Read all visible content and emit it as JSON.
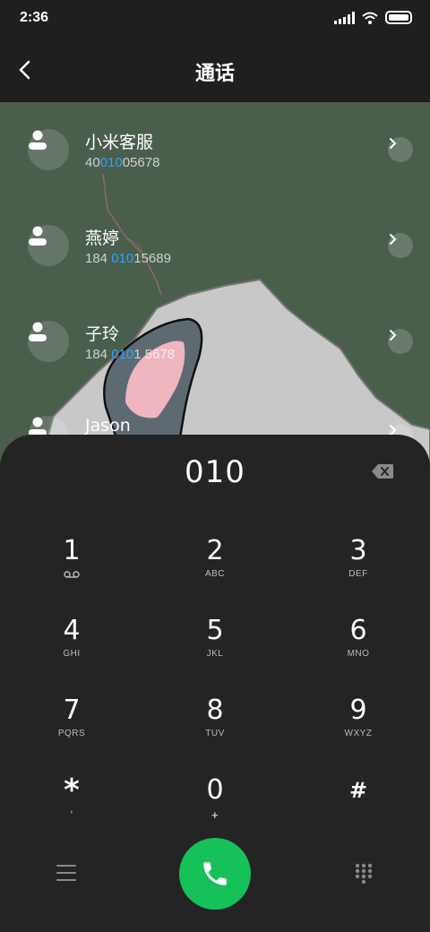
{
  "status_bar": {
    "time": "2:36"
  },
  "header": {
    "title": "通话"
  },
  "contacts": [
    {
      "name": "小米客服",
      "number_pre": "40",
      "number_match": "010",
      "number_post": "05678"
    },
    {
      "name": "燕婷",
      "number_pre": "184 ",
      "number_match": "010",
      "number_post": "15689"
    },
    {
      "name": "子玲",
      "number_pre": "184 ",
      "number_match": "010",
      "number_post": "1 5678"
    },
    {
      "name": "Jason",
      "number_pre": "",
      "number_match": "",
      "number_post": ""
    }
  ],
  "dialer": {
    "dialed_number": "010",
    "keys": [
      {
        "digit": "1",
        "letters": ""
      },
      {
        "digit": "2",
        "letters": "ABC"
      },
      {
        "digit": "3",
        "letters": "DEF"
      },
      {
        "digit": "4",
        "letters": "GHI"
      },
      {
        "digit": "5",
        "letters": "JKL"
      },
      {
        "digit": "6",
        "letters": "MNO"
      },
      {
        "digit": "7",
        "letters": "PQRS"
      },
      {
        "digit": "8",
        "letters": "TUV"
      },
      {
        "digit": "9",
        "letters": "WXYZ"
      },
      {
        "digit": "*",
        "letters": ","
      },
      {
        "digit": "0",
        "letters": "+"
      },
      {
        "digit": "#",
        "letters": ""
      }
    ]
  },
  "colors": {
    "accent_match": "#2aa5ff",
    "call_button": "#16c15a",
    "wallpaper": "#4a5e4c"
  },
  "icons": {
    "back": "chevron-left-icon",
    "contact_avatar": "person-icon",
    "row_action": "chevron-right-icon",
    "backspace": "backspace-icon",
    "voicemail": "voicemail-icon",
    "menu": "menu-icon",
    "call": "phone-icon",
    "keypad": "keypad-icon"
  }
}
